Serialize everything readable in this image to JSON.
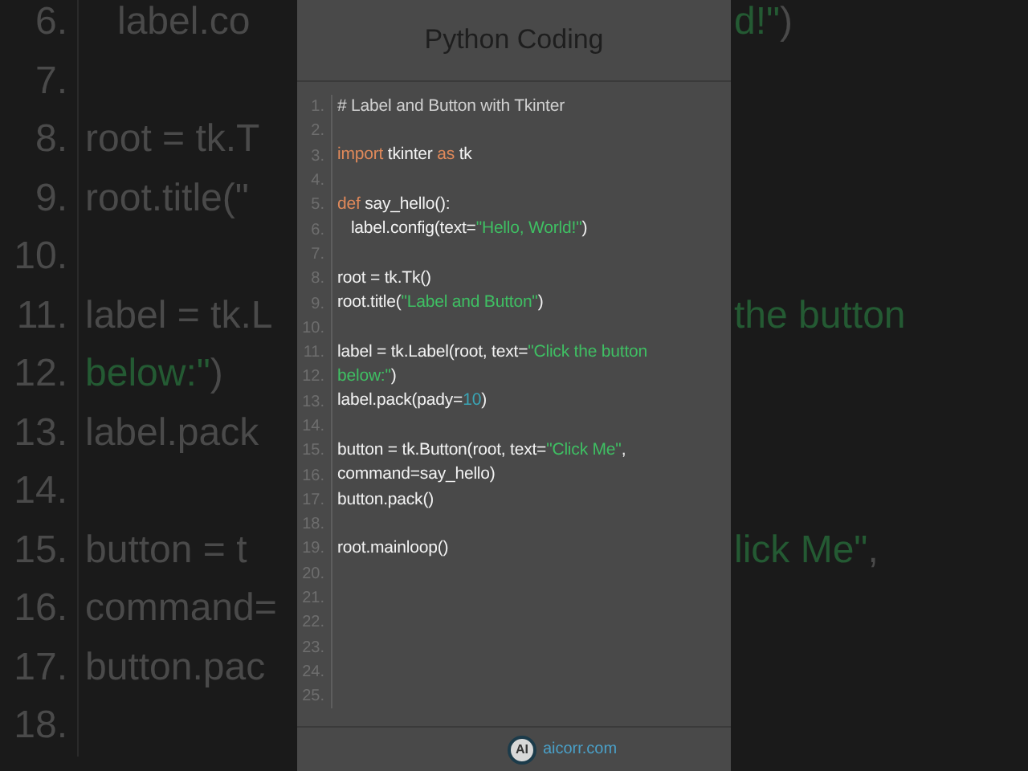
{
  "background": {
    "lines": [
      {
        "number": "6.",
        "tokens": [
          {
            "text": "   label.co",
            "kind": "plain"
          }
        ],
        "right_tokens": [
          {
            "text": "d!\"",
            "kind": "string"
          },
          {
            "text": ")",
            "kind": "plain"
          }
        ]
      },
      {
        "number": "7."
      },
      {
        "number": "8.",
        "tokens": [
          {
            "text": "root = tk.T",
            "kind": "plain"
          }
        ]
      },
      {
        "number": "9.",
        "tokens": [
          {
            "text": "root.title(\"",
            "kind": "plain"
          }
        ]
      },
      {
        "number": "10."
      },
      {
        "number": "11.",
        "tokens": [
          {
            "text": "label = tk.L",
            "kind": "plain"
          }
        ],
        "right_tokens": [
          {
            "text": "the button",
            "kind": "string"
          }
        ]
      },
      {
        "number": "12.",
        "tokens": [
          {
            "text": "below:\"",
            "kind": "string"
          },
          {
            "text": ")",
            "kind": "plain"
          }
        ]
      },
      {
        "number": "13.",
        "tokens": [
          {
            "text": "label.pack",
            "kind": "plain"
          }
        ]
      },
      {
        "number": "14."
      },
      {
        "number": "15.",
        "tokens": [
          {
            "text": "button = t",
            "kind": "plain"
          }
        ],
        "right_tokens": [
          {
            "text": "lick Me\"",
            "kind": "string"
          },
          {
            "text": ",",
            "kind": "plain"
          }
        ]
      },
      {
        "number": "16.",
        "tokens": [
          {
            "text": "command=",
            "kind": "plain"
          }
        ]
      },
      {
        "number": "17.",
        "tokens": [
          {
            "text": "button.pac",
            "kind": "plain"
          }
        ]
      },
      {
        "number": "18."
      }
    ]
  },
  "panel": {
    "title": "Python Coding",
    "lines": [
      {
        "number": "1.",
        "tokens": [
          {
            "text": "# Label and Button with Tkinter",
            "kind": "comment"
          }
        ]
      },
      {
        "number": "2."
      },
      {
        "number": "3.",
        "tokens": [
          {
            "text": "import",
            "kind": "keyword"
          },
          {
            "text": " tkinter ",
            "kind": "plain"
          },
          {
            "text": "as",
            "kind": "keyword"
          },
          {
            "text": " tk",
            "kind": "plain"
          }
        ]
      },
      {
        "number": "4."
      },
      {
        "number": "5.",
        "tokens": [
          {
            "text": "def",
            "kind": "keyword"
          },
          {
            "text": " say_hello():",
            "kind": "plain"
          }
        ]
      },
      {
        "number": "6.",
        "tokens": [
          {
            "text": "   label.config(text=",
            "kind": "plain"
          },
          {
            "text": "\"Hello, World!\"",
            "kind": "string"
          },
          {
            "text": ")",
            "kind": "plain"
          }
        ]
      },
      {
        "number": "7."
      },
      {
        "number": "8.",
        "tokens": [
          {
            "text": "root = tk.Tk()",
            "kind": "plain"
          }
        ]
      },
      {
        "number": "9.",
        "tokens": [
          {
            "text": "root.title(",
            "kind": "plain"
          },
          {
            "text": "\"Label and Button\"",
            "kind": "string"
          },
          {
            "text": ")",
            "kind": "plain"
          }
        ]
      },
      {
        "number": "10."
      },
      {
        "number": "11.",
        "tokens": [
          {
            "text": "label = tk.Label(root, text=",
            "kind": "plain"
          },
          {
            "text": "\"Click the button",
            "kind": "string"
          }
        ]
      },
      {
        "number": "12.",
        "tokens": [
          {
            "text": "below:\"",
            "kind": "string"
          },
          {
            "text": ")",
            "kind": "plain"
          }
        ]
      },
      {
        "number": "13.",
        "tokens": [
          {
            "text": "label.pack(pady=",
            "kind": "plain"
          },
          {
            "text": "10",
            "kind": "number"
          },
          {
            "text": ")",
            "kind": "plain"
          }
        ]
      },
      {
        "number": "14."
      },
      {
        "number": "15.",
        "tokens": [
          {
            "text": "button = tk.Button(root, text=",
            "kind": "plain"
          },
          {
            "text": "\"Click Me\"",
            "kind": "string"
          },
          {
            "text": ",",
            "kind": "plain"
          }
        ]
      },
      {
        "number": "16.",
        "tokens": [
          {
            "text": "command=say_hello)",
            "kind": "plain"
          }
        ]
      },
      {
        "number": "17.",
        "tokens": [
          {
            "text": "button.pack()",
            "kind": "plain"
          }
        ]
      },
      {
        "number": "18."
      },
      {
        "number": "19.",
        "tokens": [
          {
            "text": "root.mainloop()",
            "kind": "plain"
          }
        ]
      },
      {
        "number": "20."
      },
      {
        "number": "21."
      },
      {
        "number": "22."
      },
      {
        "number": "23."
      },
      {
        "number": "24."
      },
      {
        "number": "25."
      }
    ],
    "footer": {
      "logo_text": "AI",
      "site": "aicorr.com"
    }
  }
}
